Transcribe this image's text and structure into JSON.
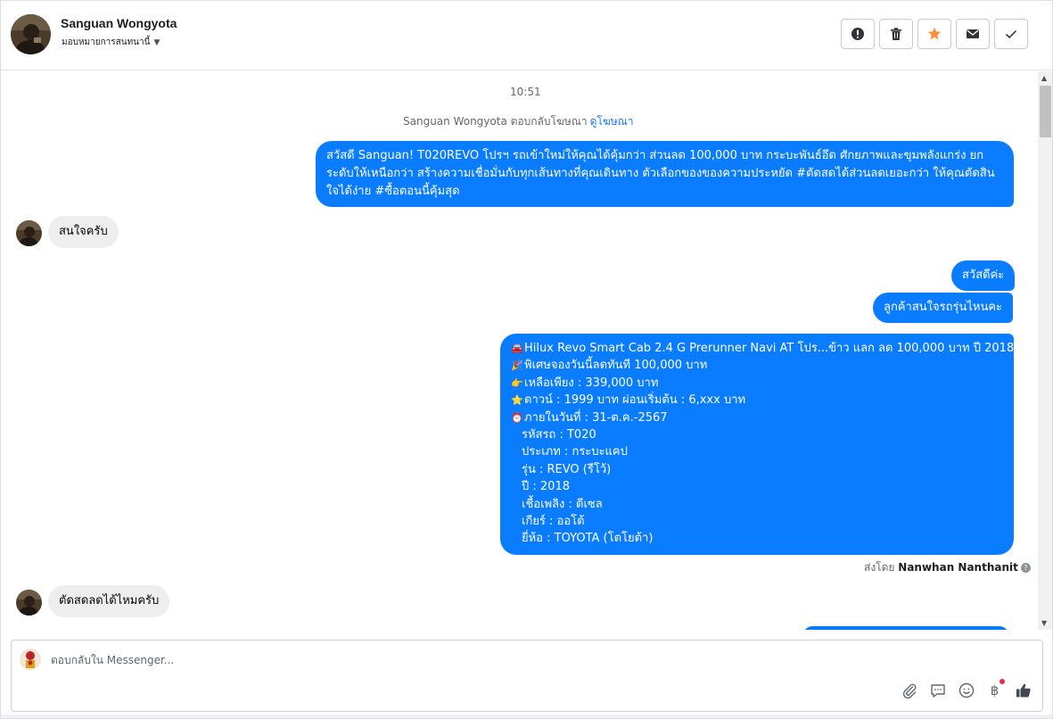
{
  "header": {
    "contact_name": "Sanguan Wongyota",
    "assign_label": "มอบหมายการสนทนานี้",
    "actions": [
      {
        "icon": "alert-icon",
        "name": "mark-spam-button"
      },
      {
        "icon": "trash-icon",
        "name": "delete-button"
      },
      {
        "icon": "star-icon",
        "name": "star-button"
      },
      {
        "icon": "envelope-icon",
        "name": "mark-unread-button"
      },
      {
        "icon": "check-icon",
        "name": "mark-done-button"
      }
    ]
  },
  "conversation": {
    "timestamp": "10:51",
    "reply_note": "Sanguan Wongyota ตอบกลับโฆษณา",
    "reply_note_link": "ดูโฆษณา",
    "messages": [
      {
        "from": "page",
        "text": "สวัสดี Sanguan!  T020REVO  โปรฯ รถเข้าใหม่ให้คุณได้คุ้มกว่า ส่วนลด 100,000 บาท กระบะพันธ์อึด ศักยภาพและขุมพลังแกร่ง  ยกระดับให้เหนือกว่า สร้างความเชื่อมั่นกับทุกเส้นทางที่คุณเดินทาง ตัวเลือกของของความประหยัด #ตัดสดได้ส่วนลดเยอะกว่า ให้คุณตัดสินใจได้ง่าย #ซื้อตอนนี้คุ้มสุด"
      },
      {
        "from": "customer",
        "text": "สนใจครับ"
      },
      {
        "from": "page",
        "text": "สวัสดีค่ะ"
      },
      {
        "from": "page",
        "text": "ลูกค้าสนใจรถรุ่นไหนคะ"
      },
      {
        "from": "page",
        "lines": [
          {
            "emoji": "🚘",
            "text": "Hilux Revo Smart Cab 2.4 G Prerunner Navi AT โปร...ข้าว แลก ลด 100,000 บาท ปี 2018"
          },
          {
            "emoji": "🎉",
            "text": "พิเศษจองวันนี้ลดทันที 100,000 บาท"
          },
          {
            "emoji": "👉",
            "text": "เหลือเพียง : 339,000 บาท"
          },
          {
            "emoji": "⭐",
            "text": "ดาวน์ : 1999 บาท ผ่อนเริ่มต้น : 6,xxx บาท"
          },
          {
            "emoji": "⏰",
            "text": "ภายในวันที่ : 31-ต.ค.-2567"
          },
          {
            "emoji": "",
            "text": "รหัสรถ : T020"
          },
          {
            "emoji": "",
            "text": "ประเภท : กระบะแคป"
          },
          {
            "emoji": "",
            "text": "รุ่น : REVO (รีโว้)"
          },
          {
            "emoji": "",
            "text": "ปี : 2018"
          },
          {
            "emoji": "",
            "text": "เชื้อเพลิง : ดีเซล"
          },
          {
            "emoji": "",
            "text": "เกียร์ : ออโต้"
          },
          {
            "emoji": "",
            "text": "ยี่ห้อ : TOYOTA (โตโยต้า)"
          }
        ]
      },
      {
        "from": "customer",
        "text": "ตัดสดลดได้ไหมครับ"
      }
    ],
    "sent_by_label": "ส่งโดย",
    "sent_by_name": "Nanwhan Nanthanit"
  },
  "composer": {
    "placeholder": "ตอบกลับใน Messenger...",
    "tools": [
      "paperclip-icon",
      "saved-replies-icon",
      "emoji-icon",
      "baht-icon",
      "like-icon"
    ],
    "baht_symbol": "฿"
  },
  "colors": {
    "outgoing_bubble": "#0a7cff",
    "incoming_bubble": "#eeeeee",
    "star": "#f7923b",
    "link": "#1877f2"
  }
}
